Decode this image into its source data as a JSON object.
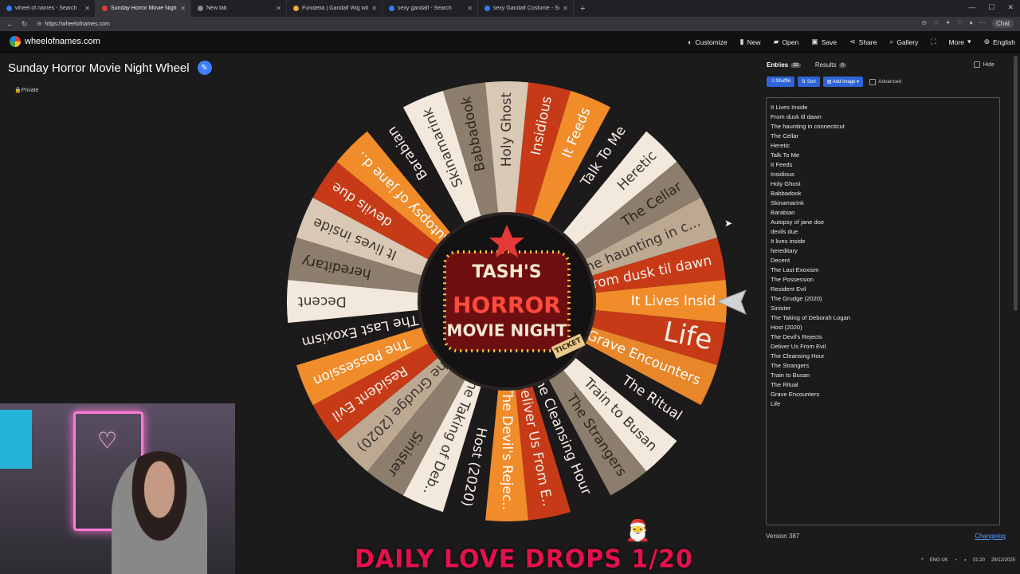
{
  "browser": {
    "tabs": [
      {
        "label": "wheel of names - Search",
        "active": false,
        "color": "#2f7df6"
      },
      {
        "label": "Sunday Horror Movie Night Wheel",
        "active": true,
        "color": "#e53935"
      },
      {
        "label": "New tab",
        "active": false,
        "color": "#888888"
      },
      {
        "label": "Funidelia | Gandalf Wig with Beard",
        "active": false,
        "color": "#f2a93b"
      },
      {
        "label": "sexy gandalf - Search",
        "active": false,
        "color": "#2f7df6"
      },
      {
        "label": "sexy Gandalf Costume - Search Im",
        "active": false,
        "color": "#2f7df6"
      }
    ],
    "url": "https://wheelofnames.com",
    "chat_label": "Chat"
  },
  "site": {
    "logo_text": "wheelofnames.com",
    "menu": [
      "Customize",
      "New",
      "Open",
      "Save",
      "Share",
      "Gallery",
      "More",
      "English"
    ]
  },
  "wheel_title": "Sunday Horror Movie Night Wheel",
  "private_label": "Private",
  "center_logo": {
    "line1": "TASH'S",
    "line2": "HORROR",
    "line3": "MOVIE NIGHT",
    "ticket": "TICKET"
  },
  "panel": {
    "tab_entries": "Entries",
    "entries_count": "32",
    "tab_results": "Results",
    "results_count": "0",
    "hide_label": "Hide",
    "btn_shuffle": "Shuffle",
    "btn_sort": "Sort",
    "btn_add_image": "Add image",
    "advanced_label": "Advanced",
    "version": "Version 387",
    "changelog": "Changelog"
  },
  "entries": [
    "It Lives Inside",
    "From dusk til dawn",
    "The haunting in connecticut",
    "The Cellar",
    "Heretic",
    "Talk To Me",
    "It Feeds",
    "Insidious",
    "Holy Ghost",
    "Babbadook",
    "Skinamarink",
    "Barabian",
    "Autopsy of jane doe",
    "devils due",
    "It lives inside",
    "hereditary",
    "Decent",
    "The Last Exoxism",
    "The Possession",
    "Resident Evil",
    "The Grudge (2020)",
    "Sinister",
    "The Taking of Deborah Logan",
    "Host (2020)",
    "The Devil's Rejects",
    "Deliver Us From Evil",
    "The Cleansing Hour",
    "The Strangers",
    "Train to Busan",
    "The Ritual",
    "Grave Encounters",
    "Life"
  ],
  "wheel_slices": [
    {
      "label": "It Lives Insid",
      "color": "#f08c2a"
    },
    {
      "label": "Life",
      "color": "#c63a18"
    },
    {
      "label": "Grave Encounters",
      "color": "#e8862a"
    },
    {
      "label": "The Ritual",
      "color": "#1c1a1a"
    },
    {
      "label": "Train to Busan",
      "color": "#f2e8dc"
    },
    {
      "label": "The Strangers",
      "color": "#8c7d6c"
    },
    {
      "label": "The Cleansing Hour",
      "color": "#1c1a1a"
    },
    {
      "label": "Deliver Us From E..",
      "color": "#c63a18"
    },
    {
      "label": "The Devil's Rejec..",
      "color": "#f08c2a"
    },
    {
      "label": "Host (2020)",
      "color": "#1c1a1a"
    },
    {
      "label": "The Taking of Deb..",
      "color": "#f2e8dc"
    },
    {
      "label": "Sinister",
      "color": "#8c7d6c"
    },
    {
      "label": "The Grudge (2020)",
      "color": "#bda992"
    },
    {
      "label": "Resident Evil",
      "color": "#c63a18"
    },
    {
      "label": "The Possession",
      "color": "#f08c2a"
    },
    {
      "label": "The Last Exoxism",
      "color": "#1c1a1a"
    },
    {
      "label": "Decent",
      "color": "#f2e8dc"
    },
    {
      "label": "hereditary",
      "color": "#8c7d6c"
    },
    {
      "label": "It lives inside",
      "color": "#d9c8b4"
    },
    {
      "label": "devils due",
      "color": "#c63a18"
    },
    {
      "label": "Autopsy of jane d..",
      "color": "#f08c2a"
    },
    {
      "label": "Barabian",
      "color": "#1c1a1a"
    },
    {
      "label": "Skinamarink",
      "color": "#f2e8dc"
    },
    {
      "label": "Babbadook",
      "color": "#8c7d6c"
    },
    {
      "label": "Holy Ghost",
      "color": "#d9c8b4"
    },
    {
      "label": "Insidious",
      "color": "#c63a18"
    },
    {
      "label": "It Feeds",
      "color": "#f08c2a"
    },
    {
      "label": "Talk To Me",
      "color": "#1c1a1a"
    },
    {
      "label": "Heretic",
      "color": "#f2e8dc"
    },
    {
      "label": "The Cellar",
      "color": "#8c7d6c"
    },
    {
      "label": "The haunting in c...",
      "color": "#bda992"
    },
    {
      "label": "From dusk til dawn",
      "color": "#c63a18"
    }
  ],
  "overlay_text": "DAILY LOVE DROPS 1/20",
  "taskbar": {
    "lang": "ENG UK",
    "time": "01:20",
    "date": "29/12/2025"
  }
}
